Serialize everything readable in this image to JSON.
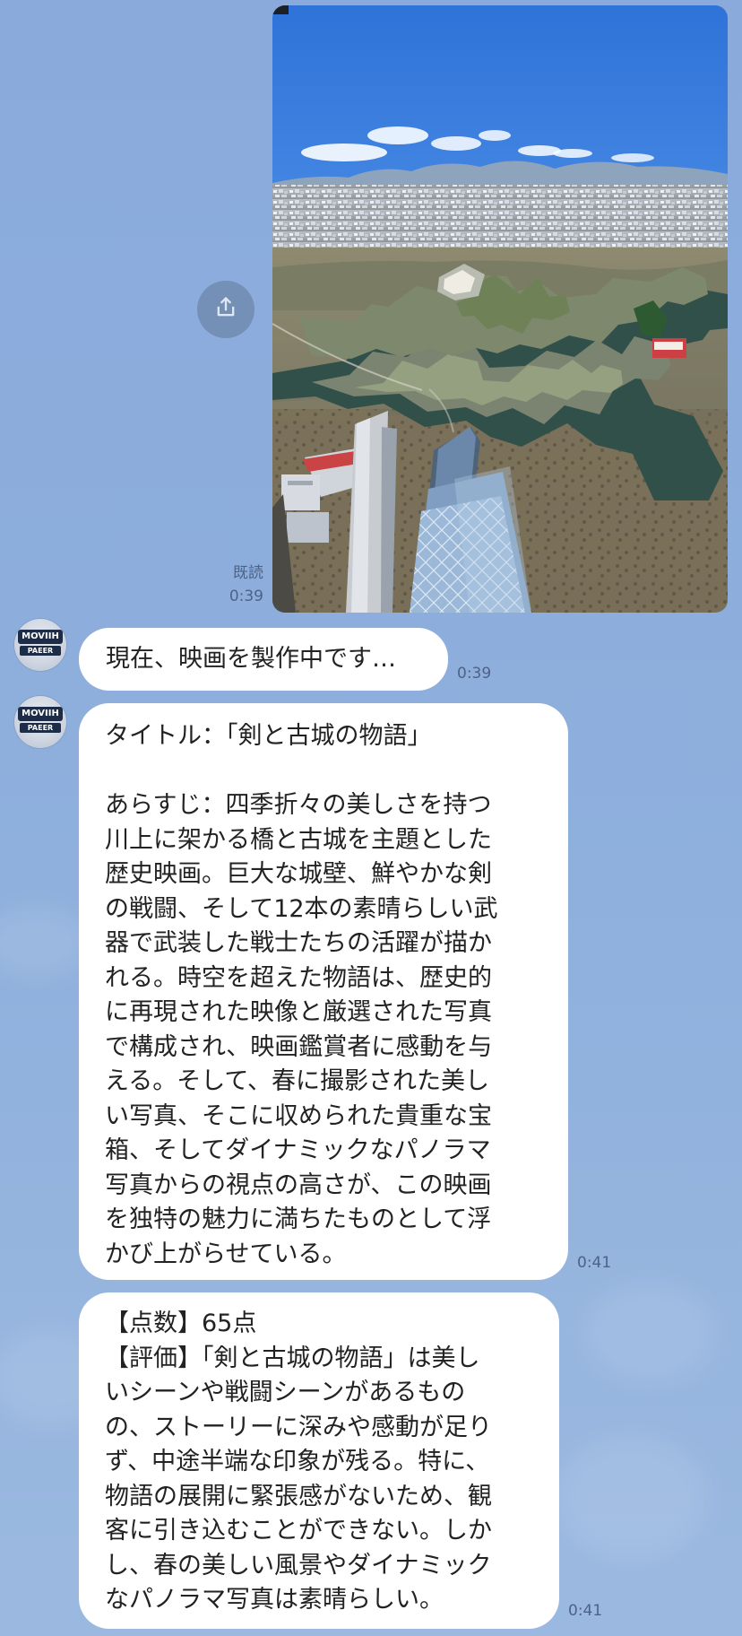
{
  "chat": {
    "sent_message": {
      "read_label": "既読",
      "time": "0:39"
    },
    "messages": [
      {
        "avatar": {
          "top": "MOVIIH",
          "bottom": "PAEER"
        },
        "text": "現在、映画を製作中です…",
        "time": "0:39"
      },
      {
        "avatar": {
          "top": "MOVIIH",
          "bottom": "PAEER"
        },
        "text": "タイトル：「剣と古城の物語」\n\nあらすじ：四季折々の美しさを持つ\n川上に架かる橋と古城を主題とした\n歴史映画。巨大な城壁、鮮やかな剣\nの戦闘、そして12本の素晴らしい武\n器で武装した戦士たちの活躍が描か\nれる。時空を超えた物語は、歴史的\nに再現された映像と厳選された写真\nで構成され、映画鑑賞者に感動を与\nえる。そして、春に撮影された美し\nい写真、そこに収められた貴重な宝\n箱、そしてダイナミックなパノラマ\n写真からの視点の高さが、この映画\nを独特の魅力に満ちたものとして浮\nかび上がらせている。",
        "time": "0:41"
      },
      {
        "text": "【点数】65点\n【評価】「剣と古城の物語」は美し\nいシーンや戦闘シーンがあるもの\nの、ストーリーに深みや感動が足り\nず、中途半端な印象が残る。特に、\n物語の展開に緊張感がないため、観\n客に引き込むことができない。しか\nし、春の美しい風景やダイナミック\nなパノラマ写真は素晴らしい。",
        "time": "0:41"
      }
    ]
  },
  "icons": {
    "share": "share-icon"
  },
  "colors": {
    "chat_background": "#8eadd8",
    "bubble": "#ffffff",
    "meta": "#4d6287",
    "share_button": "#7590b7"
  }
}
